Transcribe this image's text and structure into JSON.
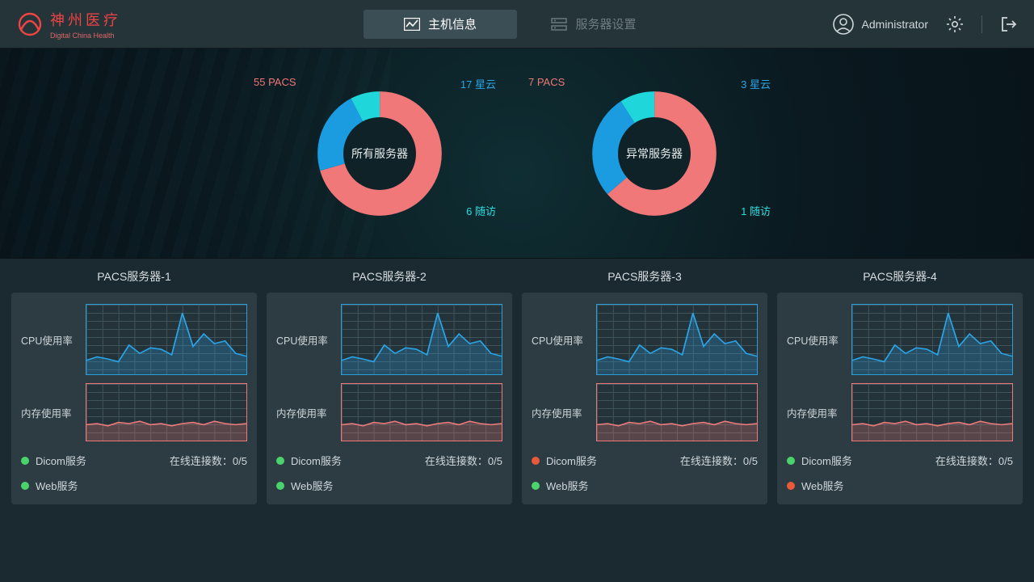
{
  "brand": {
    "name": "神州医疗",
    "sub": "Digital China Health"
  },
  "tabs": {
    "host": "主机信息",
    "server": "服务器设置"
  },
  "user": {
    "name": "Administrator"
  },
  "chart_data": [
    {
      "type": "pie",
      "title": "所有服务器",
      "series": [
        {
          "name": "PACS",
          "value": 55,
          "color": "#f07878",
          "label": "55 PACS"
        },
        {
          "name": "星云",
          "value": 17,
          "color": "#1b9be0",
          "label": "17 星云"
        },
        {
          "name": "随访",
          "value": 6,
          "color": "#1fd7db",
          "label": "6 随访"
        }
      ]
    },
    {
      "type": "pie",
      "title": "异常服务器",
      "series": [
        {
          "name": "PACS",
          "value": 7,
          "color": "#f07878",
          "label": "7 PACS"
        },
        {
          "name": "星云",
          "value": 3,
          "color": "#1b9be0",
          "label": "3 星云"
        },
        {
          "name": "随访",
          "value": 1,
          "color": "#1fd7db",
          "label": "1 随访"
        }
      ]
    }
  ],
  "card_labels": {
    "cpu": "CPU使用率",
    "mem": "内存使用率",
    "dicom": "Dicom服务",
    "web": "Web服务",
    "conn": "在线连接数：0/5"
  },
  "servers": [
    {
      "title": "PACS服务器-1",
      "dicom_ok": true,
      "web_ok": true,
      "cpu": [
        20,
        25,
        22,
        18,
        42,
        30,
        38,
        36,
        28,
        88,
        40,
        58,
        44,
        48,
        30,
        26
      ],
      "mem": [
        28,
        30,
        26,
        32,
        30,
        34,
        28,
        30,
        26,
        30,
        32,
        28,
        34,
        30,
        28,
        30
      ]
    },
    {
      "title": "PACS服务器-2",
      "dicom_ok": true,
      "web_ok": true,
      "cpu": [
        20,
        25,
        22,
        18,
        42,
        30,
        38,
        36,
        28,
        88,
        40,
        58,
        44,
        48,
        30,
        26
      ],
      "mem": [
        28,
        30,
        26,
        32,
        30,
        34,
        28,
        30,
        26,
        30,
        32,
        28,
        34,
        30,
        28,
        30
      ]
    },
    {
      "title": "PACS服务器-3",
      "dicom_ok": false,
      "web_ok": true,
      "cpu": [
        20,
        25,
        22,
        18,
        42,
        30,
        38,
        36,
        28,
        88,
        40,
        58,
        44,
        48,
        30,
        26
      ],
      "mem": [
        28,
        30,
        26,
        32,
        30,
        34,
        28,
        30,
        26,
        30,
        32,
        28,
        34,
        30,
        28,
        30
      ]
    },
    {
      "title": "PACS服务器-4",
      "dicom_ok": true,
      "web_ok": false,
      "cpu": [
        20,
        25,
        22,
        18,
        42,
        30,
        38,
        36,
        28,
        88,
        40,
        58,
        44,
        48,
        30,
        26
      ],
      "mem": [
        28,
        30,
        26,
        32,
        30,
        34,
        28,
        30,
        26,
        30,
        32,
        28,
        34,
        30,
        28,
        30
      ]
    }
  ]
}
